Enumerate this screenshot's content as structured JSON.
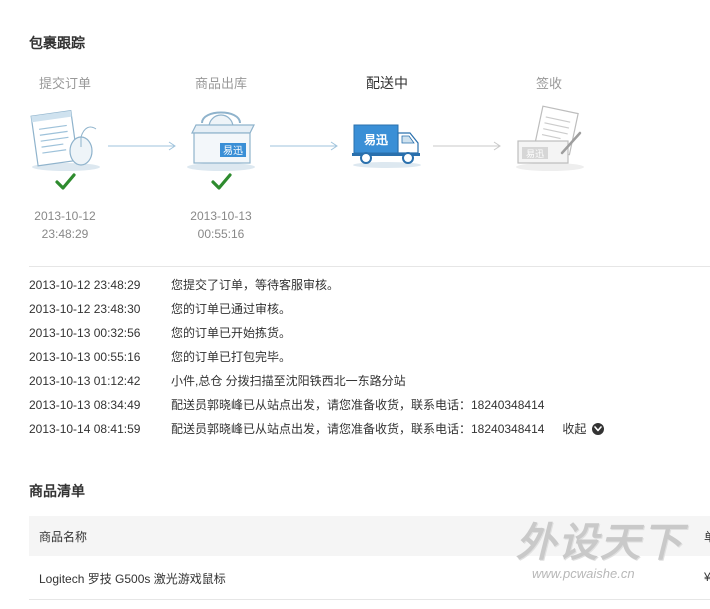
{
  "tracking": {
    "title": "包裹跟踪",
    "steps": [
      {
        "label": "提交订单",
        "status": "done",
        "date": "2013-10-12",
        "time": "23:48:29",
        "icon": "order-form-icon"
      },
      {
        "label": "商品出库",
        "status": "done",
        "date": "2013-10-13",
        "time": "00:55:16",
        "icon": "package-box-icon"
      },
      {
        "label": "配送中",
        "status": "current",
        "date": "",
        "time": "",
        "icon": "delivery-truck-icon"
      },
      {
        "label": "签收",
        "status": "pending",
        "date": "",
        "time": "",
        "icon": "sign-receipt-icon"
      }
    ],
    "courier_logo_text": "易迅",
    "log": [
      {
        "time": "2013-10-12 23:48:29",
        "text": "您提交了订单，等待客服审核。"
      },
      {
        "time": "2013-10-12 23:48:30",
        "text": "您的订单已通过审核。"
      },
      {
        "time": "2013-10-13 00:32:56",
        "text": "您的订单已开始拣货。"
      },
      {
        "time": "2013-10-13 00:55:16",
        "text": "您的订单已打包完毕。"
      },
      {
        "time": "2013-10-13 01:12:42",
        "text": "小件,总仓 分拨扫描至沈阳铁西北一东路分站"
      },
      {
        "time": "2013-10-13 08:34:49",
        "text": "配送员郭晓峰已从站点出发，请您准备收货，联系电话：18240348414"
      },
      {
        "time": "2013-10-14 08:41:59",
        "text": "配送员郭晓峰已从站点出发，请您准备收货，联系电话：18240348414"
      }
    ],
    "collapse_label": "收起"
  },
  "goods": {
    "title": "商品清单",
    "columns": {
      "name": "商品名称",
      "price": "单"
    },
    "rows": [
      {
        "name": "Logitech 罗技 G500s 激光游戏鼠标",
        "price": "¥"
      }
    ]
  },
  "watermark": {
    "logo_text": "外设天下",
    "url": "www.pcwaishe.cn"
  },
  "colors": {
    "check_green": "#2e8b2e",
    "courier_blue": "#3a8fd6",
    "muted_text": "#999999"
  }
}
